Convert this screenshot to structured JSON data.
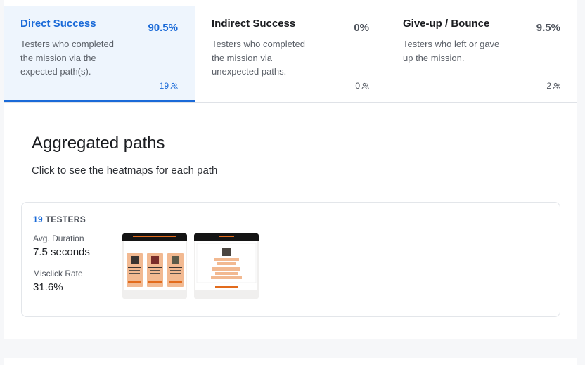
{
  "tabs": [
    {
      "title": "Direct Success",
      "percent": "90.5%",
      "description": "Testers who completed the mission via the expected path(s).",
      "count": "19",
      "icon": "people-icon",
      "active": true
    },
    {
      "title": "Indirect Success",
      "percent": "0%",
      "description": "Testers who completed the mission via unexpected paths.",
      "count": "0",
      "icon": "people-icon",
      "active": false
    },
    {
      "title": "Give-up / Bounce",
      "percent": "9.5%",
      "description": "Testers who left or gave up the mission.",
      "count": "2",
      "icon": "people-icon",
      "active": false
    }
  ],
  "section": {
    "title": "Aggregated paths",
    "subtitle": "Click to see the heatmaps for each path"
  },
  "path": {
    "testers_count": "19",
    "testers_label": "TESTERS",
    "avg_duration_label": "Avg. Duration",
    "avg_duration_value": "7.5 seconds",
    "misclick_label": "Misclick Rate",
    "misclick_value": "31.6%",
    "screens": [
      "screen-thumbnail-1",
      "screen-thumbnail-2"
    ]
  },
  "colors": {
    "accent": "#1a6ad8",
    "active_tab_bg": "#eef5fd",
    "thumbnail_accent": "#e26b1c"
  }
}
